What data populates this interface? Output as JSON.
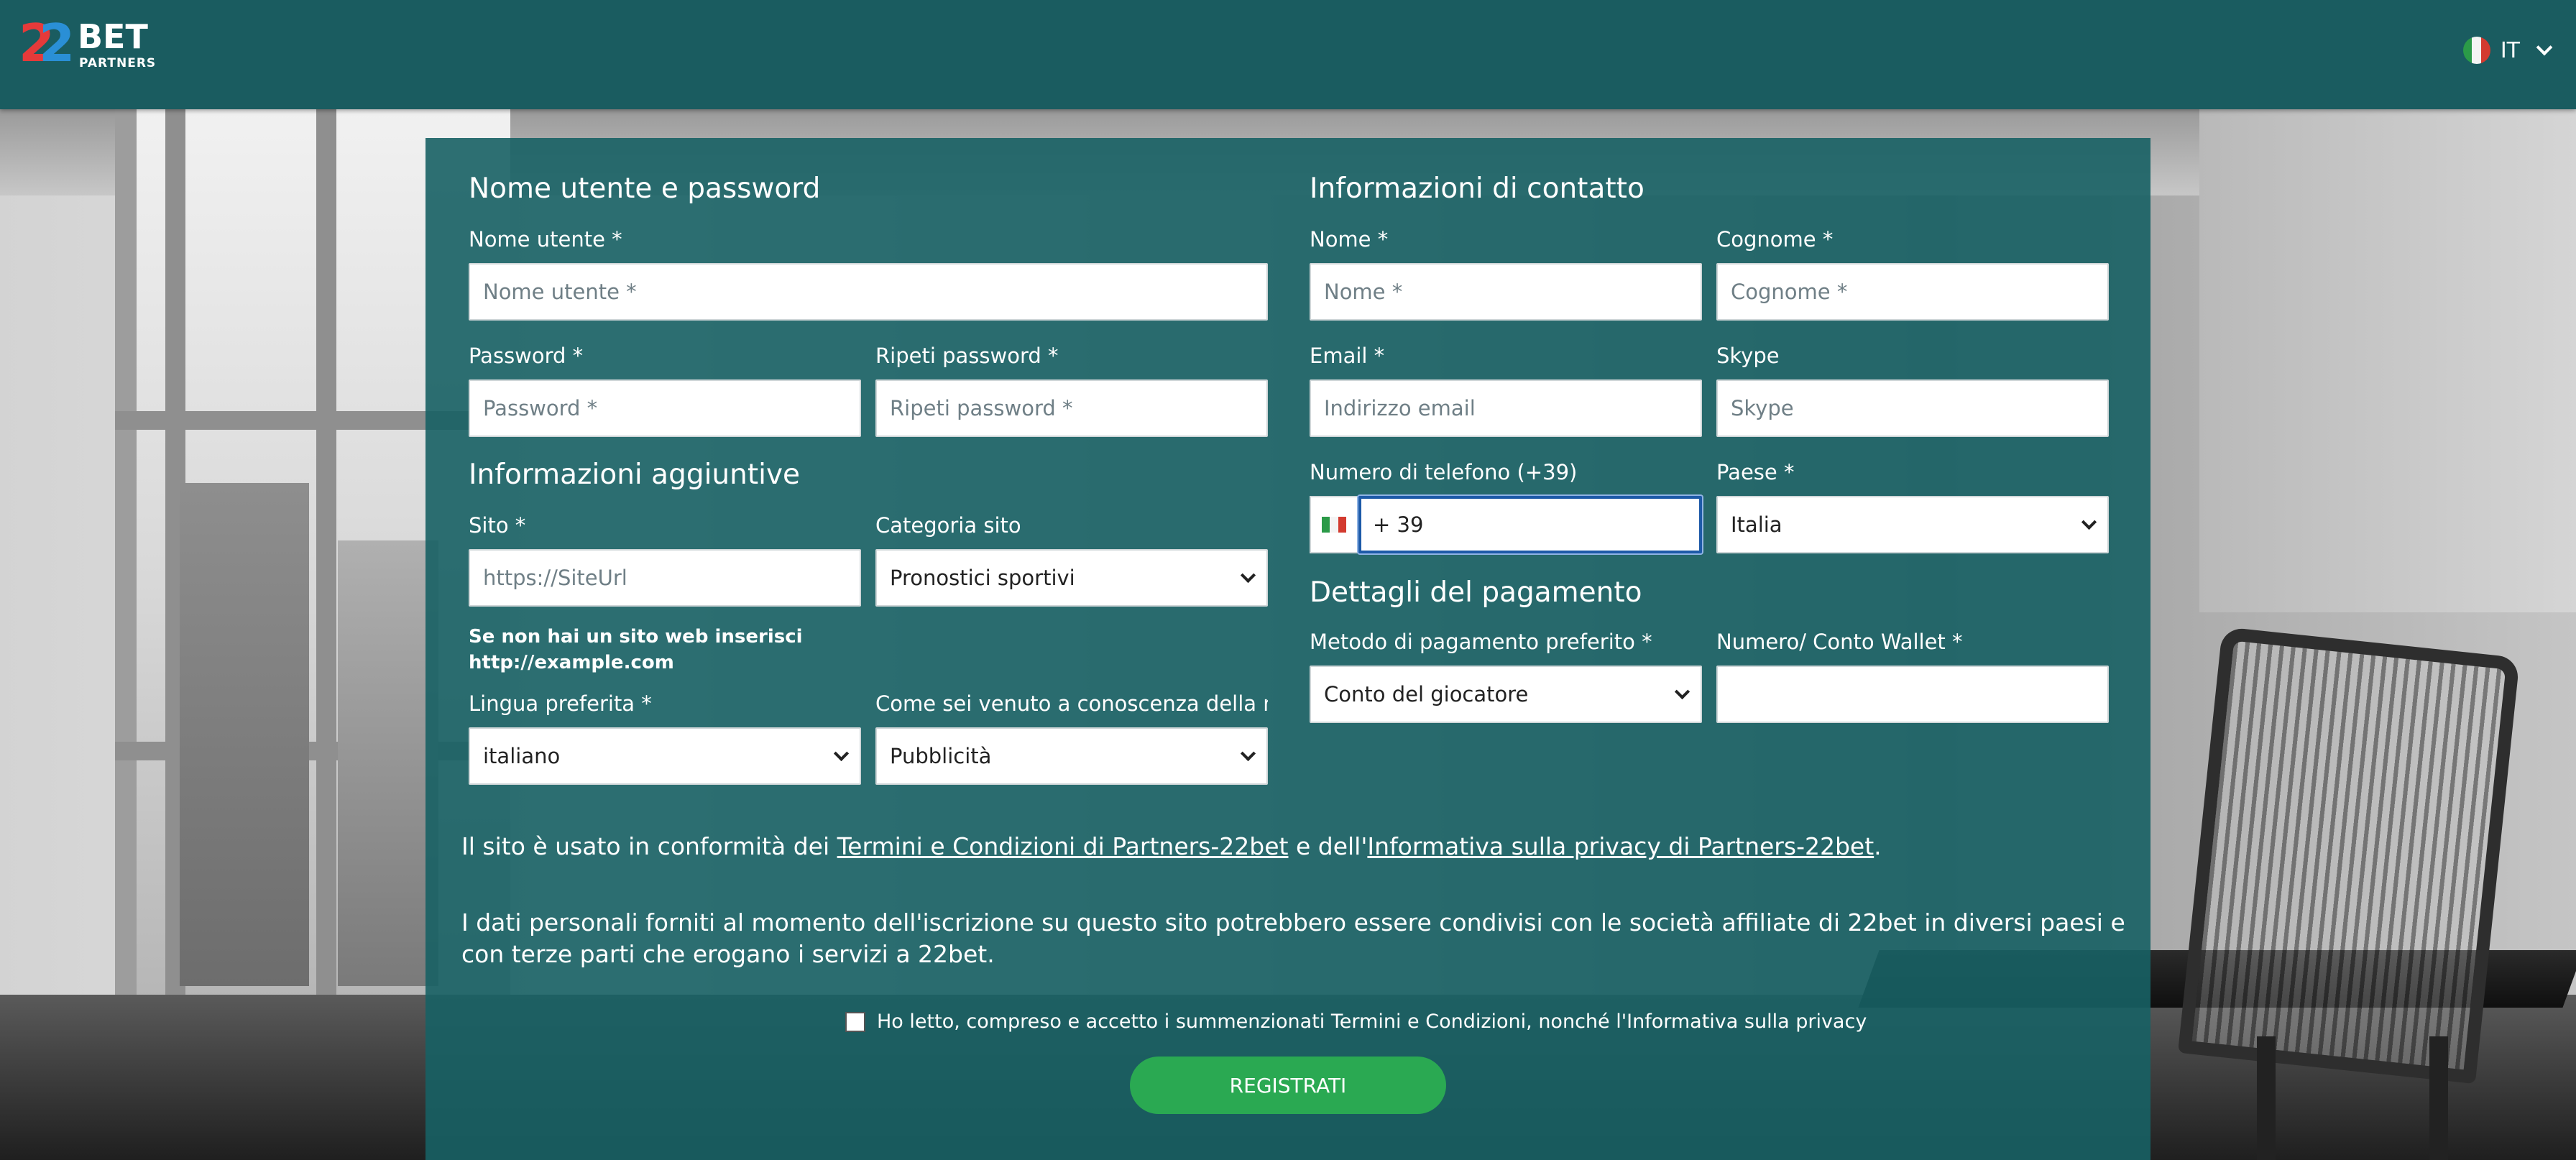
{
  "header": {
    "logo": {
      "digits": "22",
      "brand": "BET",
      "sub": "PARTNERS"
    },
    "language": {
      "code": "IT",
      "flag_icon": "italy-flag-icon"
    }
  },
  "login": {
    "title": "Nome utente e password",
    "username": {
      "label": "Nome utente *",
      "placeholder": "Nome utente *",
      "value": ""
    },
    "password": {
      "label": "Password *",
      "placeholder": "Password *",
      "value": ""
    },
    "password_repeat": {
      "label": "Ripeti password *",
      "placeholder": "Ripeti password *",
      "value": ""
    }
  },
  "additional": {
    "title": "Informazioni aggiuntive",
    "site": {
      "label": "Sito *",
      "placeholder": "https://SiteUrl",
      "value": ""
    },
    "site_category": {
      "label": "Categoria sito",
      "value": "Pronostici sportivi"
    },
    "site_hint_line1": "Se non hai un sito web inserisci",
    "site_hint_line2": "http://example.com",
    "language": {
      "label": "Lingua preferita *",
      "value": "italiano"
    },
    "referral": {
      "label": "Come sei venuto a conoscenza della nostra",
      "value": "Pubblicità"
    }
  },
  "contact": {
    "title": "Informazioni di contatto",
    "first_name": {
      "label": "Nome *",
      "placeholder": "Nome *",
      "value": ""
    },
    "last_name": {
      "label": "Cognome *",
      "placeholder": "Cognome *",
      "value": ""
    },
    "email": {
      "label": "Email *",
      "placeholder": "Indirizzo email",
      "value": ""
    },
    "skype": {
      "label": "Skype",
      "placeholder": "Skype",
      "value": ""
    },
    "phone": {
      "label": "Numero di telefono (+39)",
      "value": "+ 39",
      "flag_icon": "italy-flag-icon"
    },
    "country": {
      "label": "Paese *",
      "value": "Italia"
    }
  },
  "payment": {
    "title": "Dettagli del pagamento",
    "method": {
      "label": "Metodo di pagamento preferito *",
      "value": "Conto del giocatore"
    },
    "wallet": {
      "label": "Numero/ Conto Wallet *",
      "value": ""
    }
  },
  "legal": {
    "p1_prefix": "Il sito è usato in conformità dei ",
    "p1_link1": "Termini e Condizioni di Partners-22bet",
    "p1_middle": " e dell'",
    "p1_link2": "Informativa sulla privacy di Partners-22bet",
    "p1_suffix": ".",
    "p2": "I dati personali forniti al momento dell'iscrizione su questo sito potrebbero essere condivisi con le società affiliate di 22bet in diversi paesi e con terze parti che erogano i servizi a 22bet.",
    "consent": "Ho letto, compreso e accetto i summenzionati Termini e Condizioni, nonché l'Informativa sulla privacy",
    "consent_checked": false
  },
  "submit_label": "REGISTRATI",
  "colors": {
    "header": "#1a5c60",
    "panel": "#176064",
    "button": "#2aa952",
    "focus_border": "#1d5aa8"
  }
}
